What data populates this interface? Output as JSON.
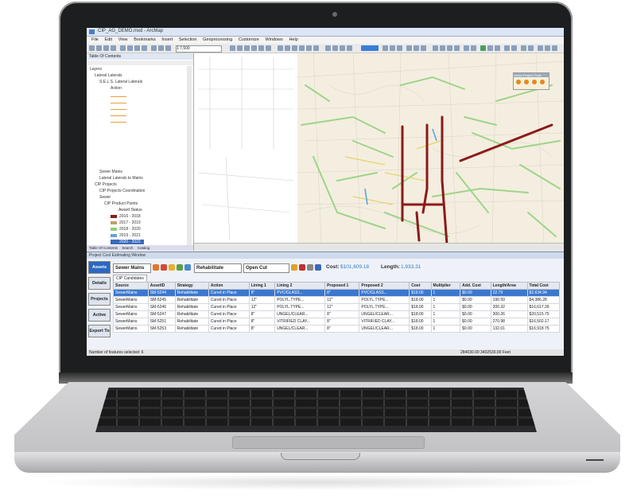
{
  "window": {
    "title": "CIP_AG_DEMO.mxd - ArcMap"
  },
  "menu": [
    "File",
    "Edit",
    "View",
    "Bookmarks",
    "Insert",
    "Selection",
    "Geoprocessing",
    "Customize",
    "Windows",
    "Help"
  ],
  "toolbar": {
    "scale_value": "1:7,500"
  },
  "toc": {
    "header": "Table Of Contents",
    "items": [
      "Layers",
      "Lateral Laterals",
      "S.E.L.S. Lateral Laterals",
      "Action",
      "Sewer Mains",
      "Lateral Laterals to Mains",
      "CIP Projects",
      "CIP Projects Coordination",
      "Sewer",
      "CIP Product Points",
      "Award Status"
    ],
    "legend": [
      {
        "label": "2016 - 2018",
        "color": "#8b1a1a"
      },
      {
        "label": "2017 - 2019",
        "color": "#c0a070"
      },
      {
        "label": "2018 - 2020",
        "color": "#8ed06a"
      },
      {
        "label": "2019 - 2021",
        "color": "#6aa0d8"
      },
      {
        "label": "2020 - 2022",
        "color": "#3a6ab8"
      }
    ],
    "tabs": [
      "Table Of Contents",
      "Search",
      "Catalog"
    ]
  },
  "bottom": {
    "title": "Project Cost Estimating Window",
    "side_buttons": [
      "Assets",
      "Details",
      "Projects",
      "Active",
      "Export To"
    ],
    "asset_select": "Sewer Mains",
    "strategy_select": "Rehabilitate",
    "method_select": "Open Cut",
    "cost_label": "Cost:",
    "cost_value": "$101,609.18",
    "length_label": "Length:",
    "length_value": "1,933.31",
    "tab": "CIP Candidates",
    "columns": [
      "Source",
      "AssetID",
      "Strategy",
      "Action",
      "Lining 1",
      "Lining 2",
      "Proposed 1",
      "Proposed 2",
      "Cost",
      "Multiplier",
      "Add. Cost",
      "Length/Area",
      "Total Cost"
    ],
    "rows": [
      [
        "SewerMains",
        "SM-5244",
        "Rehabilitate",
        "Cured in Place",
        "8\"",
        "PVC/GLASS...",
        "8\"",
        "PVC/GLASS...",
        "$18.00",
        "1",
        "$0.00",
        "22.79",
        "$2,634.94"
      ],
      [
        "SewerMains",
        "SM-5245",
        "Rehabilitate",
        "Cured in Place",
        "12\"",
        "POLYL.TYPE...",
        "12\"",
        "POLYL.TYPE...",
        "$18.00",
        "1",
        "$0.00",
        "190.59",
        "$4,386.28"
      ],
      [
        "SewerMains",
        "SM-5246",
        "Rehabilitate",
        "Cured in Place",
        "12\"",
        "POLYL.TYPE...",
        "12\"",
        "POLYL.TYPE...",
        "$18.00",
        "1",
        "$0.00",
        "200.32",
        "$16,617.39"
      ],
      [
        "SewerMains",
        "SM-5247",
        "Rehabilitate",
        "Cured in Place",
        "8\"",
        "UNGEL/CLEAR...",
        "8\"",
        "UNGEL/CLEAR...",
        "$18.00",
        "1",
        "$0.00",
        "300.26",
        "$20,515.75"
      ],
      [
        "SewerMains",
        "SM-5251",
        "Rehabilitate",
        "Cured in Place",
        "8\"",
        "VITRIFIED CLAY...",
        "8\"",
        "VITRIFIED CLAY...",
        "$18.00",
        "1",
        "$0.00",
        "270.98",
        "$16,502.17"
      ],
      [
        "SewerMains",
        "SM-5253",
        "Rehabilitate",
        "Cured in Place",
        "8\"",
        "UNGEL/CLEAR...",
        "8\"",
        "UNGEL/CLEAR...",
        "$18.00",
        "1",
        "$0.00",
        "132.01",
        "$16,918.75"
      ]
    ],
    "status_left": "Number of features selected: 6",
    "status_right": "284030.00  3402530.00 Feet"
  },
  "map_panel": {
    "title": "Active Project Tools"
  }
}
